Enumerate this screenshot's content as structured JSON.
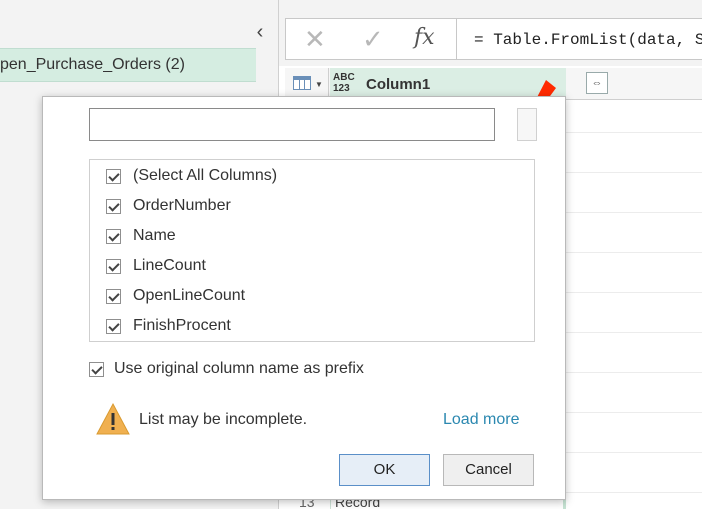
{
  "query_pane": {
    "collapse_glyph": "‹",
    "query_name": "pen_Purchase_Orders (2)"
  },
  "formula_bar": {
    "cancel_glyph": "✕",
    "ok_glyph": "✓",
    "fx_glyph": "fx",
    "formula": "= Table.FromList(data, S"
  },
  "grid": {
    "type_icon": "ABC\n123",
    "type_icon_top": "ABC",
    "type_icon_bottom": "123",
    "column_name": "Column1",
    "expand_glyph": "⇔",
    "rows": [
      {
        "num": "13",
        "value": "Record"
      }
    ]
  },
  "dialog": {
    "search": {
      "value": "",
      "placeholder": ""
    },
    "columns": [
      {
        "label": "(Select All Columns)",
        "checked": true
      },
      {
        "label": "OrderNumber",
        "checked": true
      },
      {
        "label": "Name",
        "checked": true
      },
      {
        "label": "LineCount",
        "checked": true
      },
      {
        "label": "OpenLineCount",
        "checked": true
      },
      {
        "label": "FinishProcent",
        "checked": true
      }
    ],
    "prefix_label": "Use original column name as prefix",
    "prefix_checked": true,
    "warning_text": "List may be incomplete.",
    "load_more": "Load more",
    "ok_label": "OK",
    "cancel_label": "Cancel"
  },
  "colors": {
    "selected_query": "#d5ede1",
    "selected_column": "#dbeee4",
    "link": "#2b88b0",
    "warning": "#f0b050",
    "annotation_arrow": "#ff2a00"
  }
}
